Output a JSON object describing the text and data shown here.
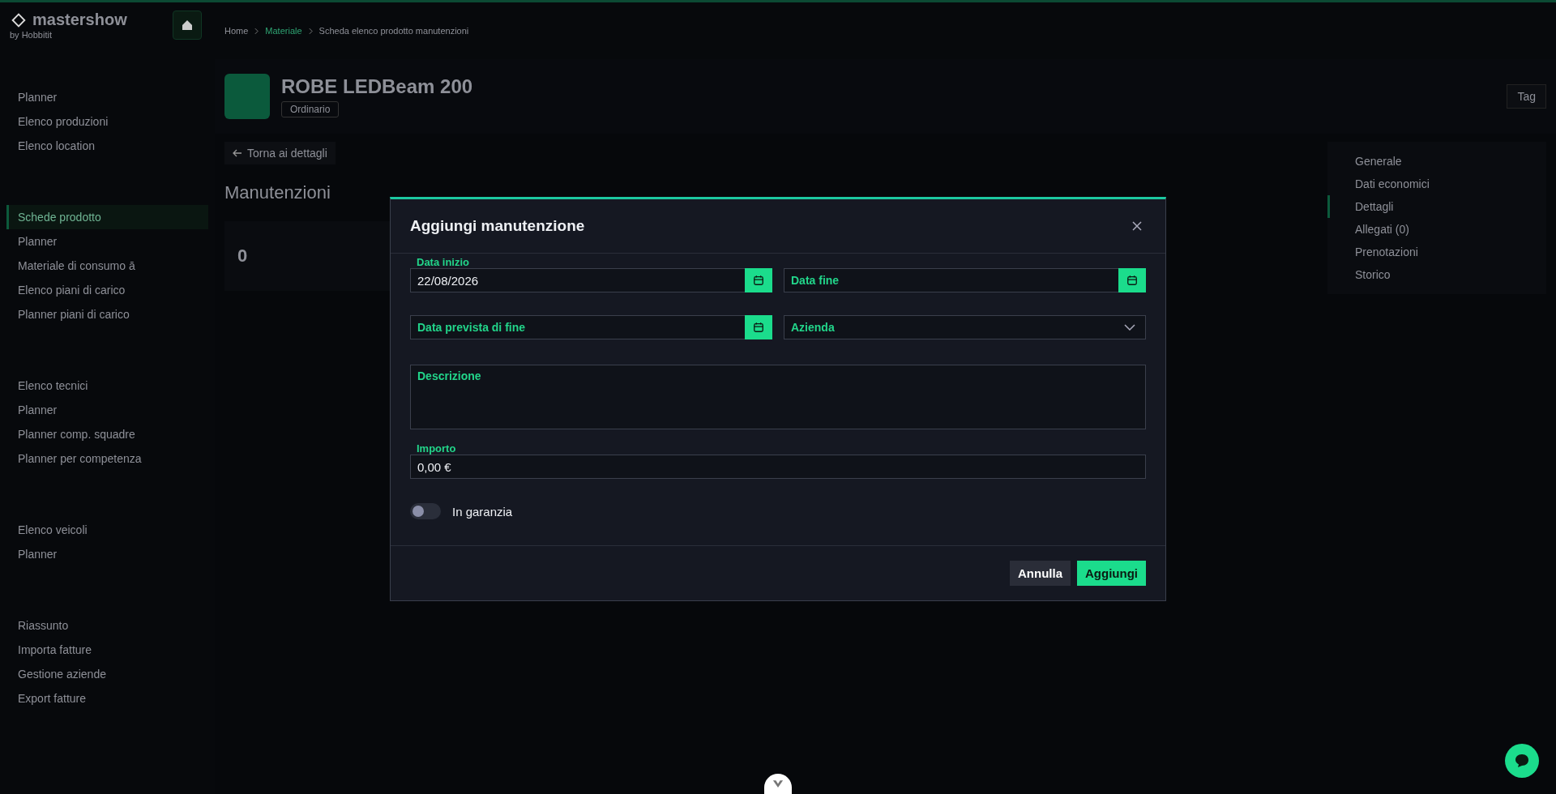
{
  "sidebar": {
    "brand": "mastershow",
    "brand_sub": "by Hobbitit",
    "sections": [
      {
        "items": [
          {
            "label": "Planner",
            "selected": false
          },
          {
            "label": "Elenco produzioni",
            "selected": false
          },
          {
            "label": "Elenco location",
            "selected": false
          }
        ]
      },
      {
        "items": [
          {
            "label": "Schede prodotto",
            "selected": true
          },
          {
            "label": "Planner",
            "selected": false
          },
          {
            "label": "Materiale di consumo ā",
            "selected": false
          },
          {
            "label": "Elenco piani di carico",
            "selected": false
          },
          {
            "label": "Planner piani di carico",
            "selected": false
          }
        ]
      },
      {
        "items": [
          {
            "label": "Elenco tecnici",
            "selected": false
          },
          {
            "label": "Planner",
            "selected": false
          },
          {
            "label": "Planner comp. squadre",
            "selected": false
          },
          {
            "label": "Planner per competenza",
            "selected": false
          }
        ]
      },
      {
        "items": [
          {
            "label": "Elenco veicoli",
            "selected": false
          },
          {
            "label": "Planner",
            "selected": false
          }
        ]
      },
      {
        "items": [
          {
            "label": "Riassunto",
            "selected": false
          },
          {
            "label": "Importa fatture",
            "selected": false
          },
          {
            "label": "Gestione aziende",
            "selected": false
          },
          {
            "label": "Export fatture",
            "selected": false
          }
        ]
      }
    ]
  },
  "breadcrumb": [
    "Home",
    "Materiale",
    "Scheda elenco prodotto manutenzioni"
  ],
  "product": {
    "name": "ROBE LEDBeam 200",
    "tag": "Ordinario"
  },
  "tag_button": "Tag",
  "back_button": "Torna ai dettagli",
  "section_title": "Manutenzioni",
  "stat": {
    "value": "0"
  },
  "side_nav": [
    {
      "label": "Generale",
      "selected": false
    },
    {
      "label": "Dati economici",
      "selected": false
    },
    {
      "label": "Dettagli",
      "selected": true
    },
    {
      "label": "Allegati (0)",
      "selected": false
    },
    {
      "label": "Prenotazioni",
      "selected": false
    },
    {
      "label": "Storico",
      "selected": false
    }
  ],
  "modal": {
    "title": "Aggiungi manutenzione",
    "fields": [
      {
        "kind": "date",
        "label": "Data inizio",
        "value": "22/08/2026"
      },
      {
        "kind": "date",
        "label": "Data fine"
      },
      {
        "kind": "date",
        "label": "Data prevista di fine"
      },
      {
        "kind": "select",
        "label": "Azienda"
      },
      {
        "kind": "textarea",
        "label": "Descrizione"
      },
      {
        "kind": "text",
        "label": "Importo",
        "value": "0,00 €"
      }
    ],
    "toggle": {
      "label": "In garanzia",
      "on": false
    },
    "buttons": [
      {
        "label": "Annulla",
        "kind": "secondary"
      },
      {
        "label": "Aggiungi",
        "kind": "primary"
      }
    ]
  }
}
